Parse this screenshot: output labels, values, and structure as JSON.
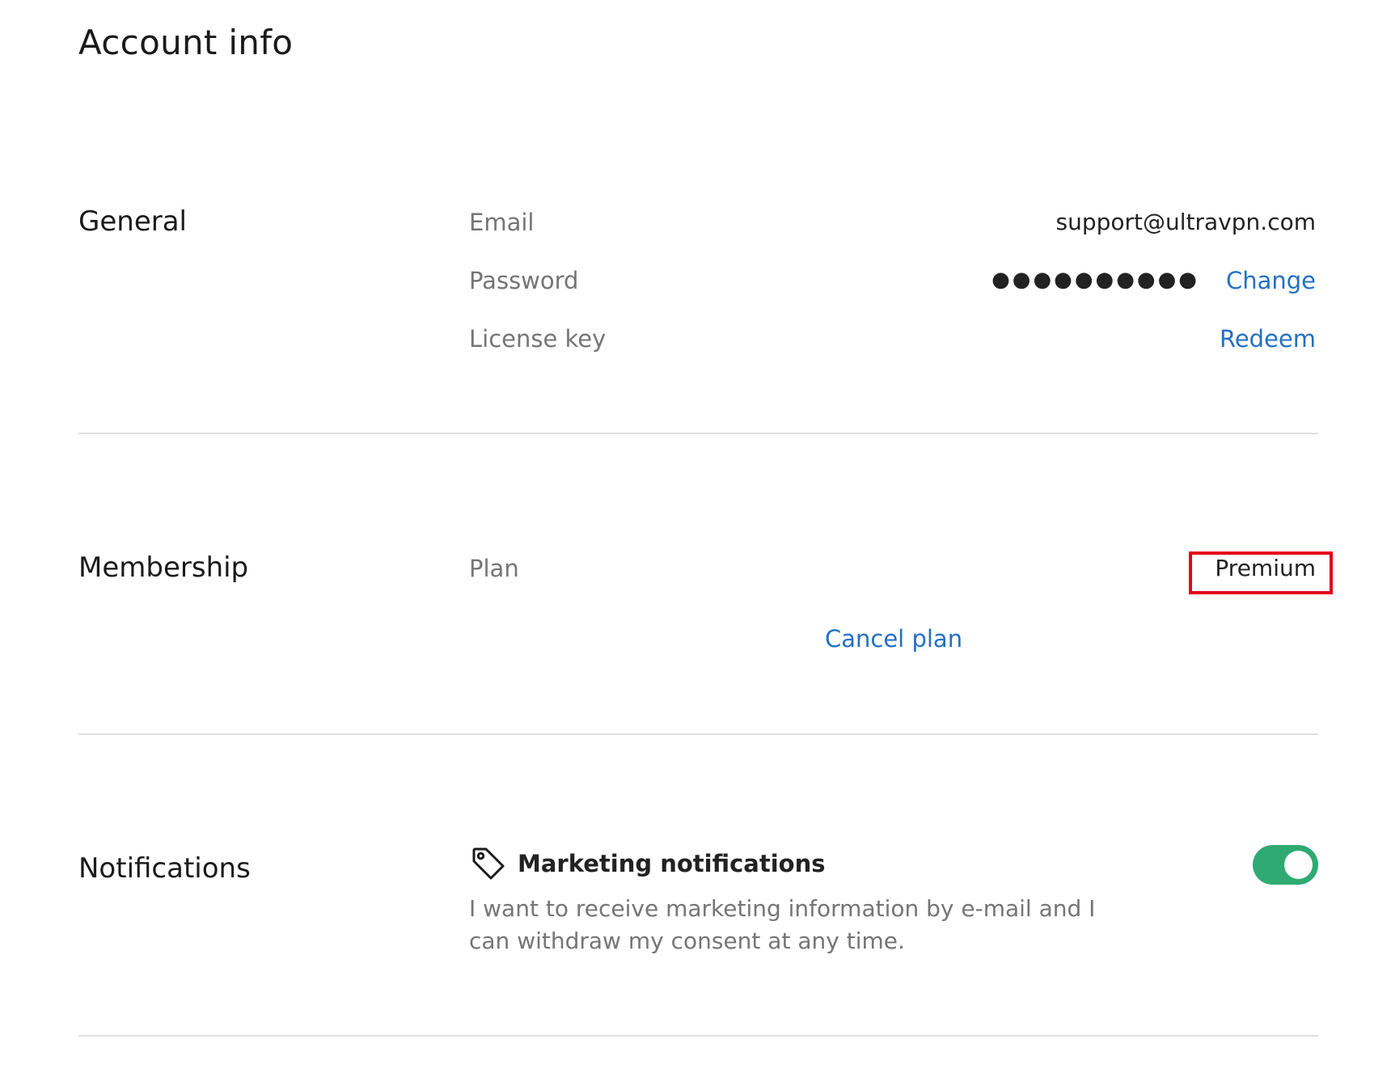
{
  "page": {
    "title": "Account info"
  },
  "general": {
    "title": "General",
    "email_label": "Email",
    "email_value": "support@ultravpn.com",
    "password_label": "Password",
    "password_mask": "●●●●●●●●●●",
    "change_label": "Change",
    "license_label": "License key",
    "redeem_label": "Redeem"
  },
  "membership": {
    "title": "Membership",
    "plan_label": "Plan",
    "plan_value": "Premium",
    "cancel_label": "Cancel plan"
  },
  "notifications": {
    "title": "Notifications",
    "icon": "tag-icon",
    "marketing_title": "Marketing notifications",
    "marketing_desc": "I want to receive marketing information by e-mail and I can withdraw my consent at any time.",
    "marketing_enabled": true
  },
  "colors": {
    "link": "#2470c4",
    "toggle_on": "#2eaa72",
    "highlight": "#e3001b",
    "label": "#757575"
  }
}
